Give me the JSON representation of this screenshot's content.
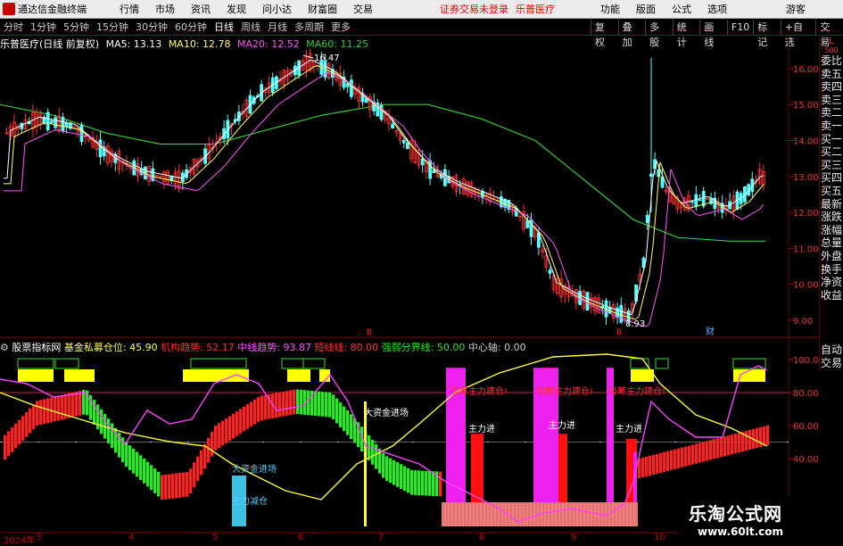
{
  "app": {
    "title": "通达信金融终端",
    "menus": [
      "行情",
      "市场",
      "资讯",
      "发现",
      "问小达",
      "财富圈",
      "交易"
    ],
    "warning": "证券交易未登录",
    "stock_title": "乐普医疗",
    "right_menus": [
      "功能",
      "版面",
      "公式",
      "选项"
    ],
    "user": "游客"
  },
  "toolbar": {
    "periods": [
      "分时",
      "1分钟",
      "5分钟",
      "15分钟",
      "30分钟",
      "60分钟",
      "日线",
      "周线",
      "月线",
      "多周期",
      "更多"
    ],
    "active": "日线",
    "right": [
      "复权",
      "叠加",
      "多股",
      "统计",
      "画线",
      "F10",
      "标记",
      "+自选",
      "交易"
    ]
  },
  "main_info": {
    "title": "乐普医疗(日线 前复权)",
    "ma5": "MA5: 13.13",
    "ma10": "MA10: 12.78",
    "ma20": "MA20: 12.52",
    "ma60": "MA60: 11.25",
    "high_label": "16.47",
    "low_label": "8.93",
    "marker1": "B",
    "marker2": "B",
    "marker3": "财"
  },
  "price_axis": [
    "16.00",
    "15.00",
    "14.00",
    "13.00",
    "12.00",
    "11.00",
    "10.00",
    "9.00"
  ],
  "right_panel": [
    "委比",
    "卖五",
    "卖四",
    "卖三",
    "卖二",
    "卖一",
    "买一",
    "买二",
    "买三",
    "买四",
    "买五",
    "最新",
    "涨跌",
    "涨幅",
    "总量",
    "外盘",
    "换手",
    "净资",
    "收益"
  ],
  "right_panel2": [
    "自动",
    "交易"
  ],
  "side_labels": {
    "top": "L",
    "sub": "500"
  },
  "indicator_info": {
    "name": "股票指标网",
    "fund": "基金私募仓位: 45.90",
    "inst": "机构趋势: 52.17",
    "mid": "中线趋势: 93.87",
    "warn": "短线线: 80.00",
    "strong": "强弱分界线: 50.00",
    "center": "中心轴: 0.00"
  },
  "indicator_axis": [
    "100.0",
    "80.00",
    "60.00",
    "40.00"
  ],
  "annotations": [
    "吸筹主力建仓!",
    "吸筹主力建仓!",
    "吸筹主力建仓!",
    "大资金进场",
    "大资金进场",
    "主力进",
    "主力进",
    "主力进",
    "主力减仓"
  ],
  "dates": {
    "year": "2024年",
    "months": [
      "3",
      "4",
      "5",
      "6",
      "7",
      "8",
      "9",
      "10"
    ]
  },
  "watermark": {
    "title": "乐淘公式网",
    "url": "www.60lt.com"
  },
  "colors": {
    "up": "#ff3030",
    "down": "#54ffff",
    "ma5": "#ffffff",
    "ma10": "#ffff55",
    "ma20": "#ff55ff",
    "ma60": "#33cc33",
    "bg": "#000000"
  }
}
